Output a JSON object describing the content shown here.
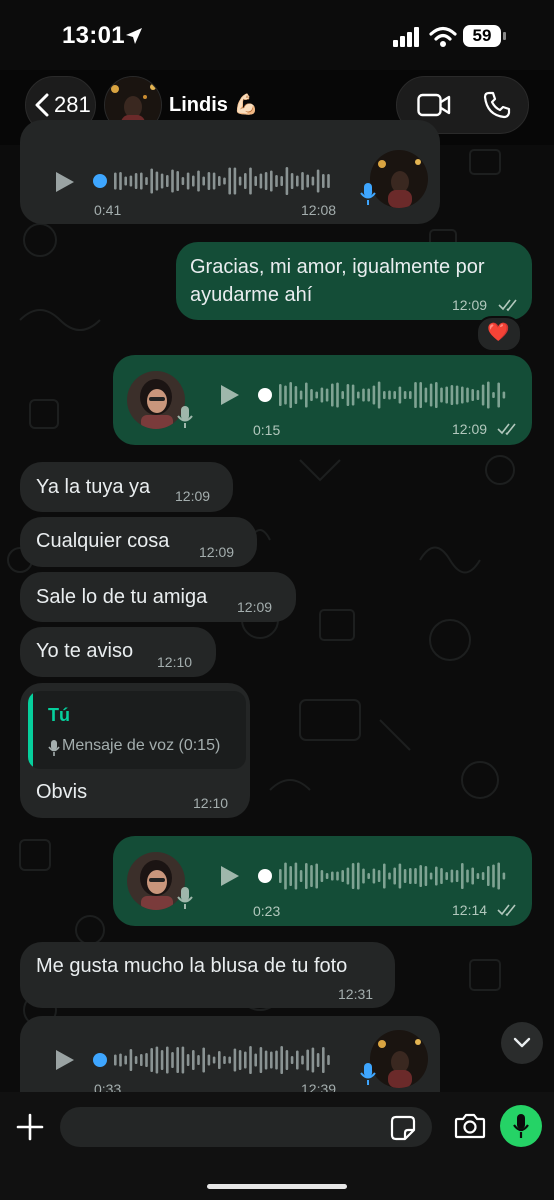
{
  "status": {
    "time": "13:01",
    "battery": "59"
  },
  "header": {
    "back_count": "281",
    "contact_name": "Lindis 💪🏻"
  },
  "messages": {
    "voice1": {
      "duration": "0:41",
      "time": "12:08"
    },
    "out1": {
      "text_line1": "Gracias, mi amor, igualmente por",
      "text_line2": "ayudarme ahí",
      "time": "12:09",
      "reaction": "❤️"
    },
    "voice2": {
      "duration": "0:15",
      "time": "12:09"
    },
    "in1": {
      "text": "Ya la tuya ya",
      "time": "12:09"
    },
    "in2": {
      "text": "Cualquier cosa",
      "time": "12:09"
    },
    "in3": {
      "text": "Sale lo de tu amiga",
      "time": "12:09"
    },
    "in4": {
      "text": "Yo te aviso",
      "time": "12:10"
    },
    "reply": {
      "quote_author": "Tú",
      "quote_text": "Mensaje de voz (0:15)",
      "text": "Obvis",
      "time": "12:10"
    },
    "voice3": {
      "duration": "0:23",
      "time": "12:14"
    },
    "in5": {
      "text": "Me gusta mucho la blusa de tu foto",
      "time": "12:31"
    },
    "voice4": {
      "duration": "0:33",
      "time": "12:39"
    }
  },
  "composer": {
    "placeholder": ""
  },
  "colors": {
    "outgoing": "#144d37",
    "incoming": "#242626",
    "accent": "#25d366",
    "quote_accent": "#06cf9c"
  },
  "icons": [
    "location-arrow-icon",
    "signal-icon",
    "wifi-icon",
    "battery-icon",
    "chevron-left-icon",
    "video-call-icon",
    "phone-icon",
    "play-icon",
    "microphone-icon",
    "double-check-icon",
    "chevron-down-icon",
    "plus-icon",
    "sticker-icon",
    "camera-icon"
  ]
}
